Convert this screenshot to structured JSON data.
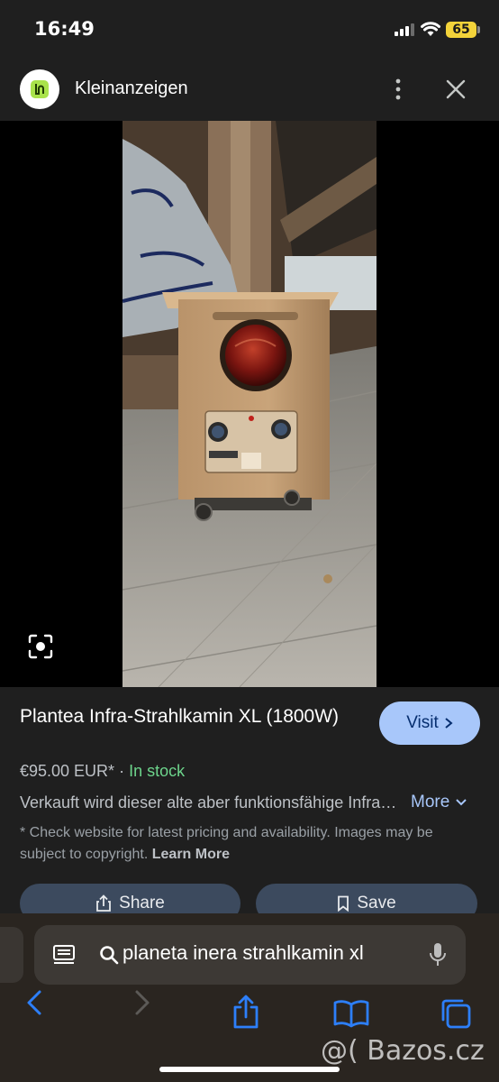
{
  "status": {
    "time": "16:49",
    "battery": "65"
  },
  "header": {
    "title": "Kleinanzeigen",
    "logo_icon": "kleinanzeigen-logo",
    "menu_icon": "kebab-icon",
    "close_icon": "close-icon"
  },
  "product": {
    "title": "Plantea Infra-Strahlkamin XL (1800W)",
    "price": "€95.00 EUR*",
    "separator": "·",
    "stock": "In stock",
    "description": "Verkauft wird dieser alte aber funktionsfähige Infra-Strahlkamin",
    "more_label": "More",
    "disclaimer": "* Check website for latest pricing and availability. Images may be subject to copyright.",
    "learn_more": "Learn More",
    "visit_label": "Visit",
    "share_label": "Share",
    "save_label": "Save"
  },
  "browser": {
    "query": "planeta inera strahlkamin xl"
  },
  "watermark": "@( Bazos.cz",
  "colors": {
    "accent": "#a8c7fa",
    "stock": "#6dd58c",
    "button": "#3c4a5e",
    "battery": "#f3d33a"
  }
}
